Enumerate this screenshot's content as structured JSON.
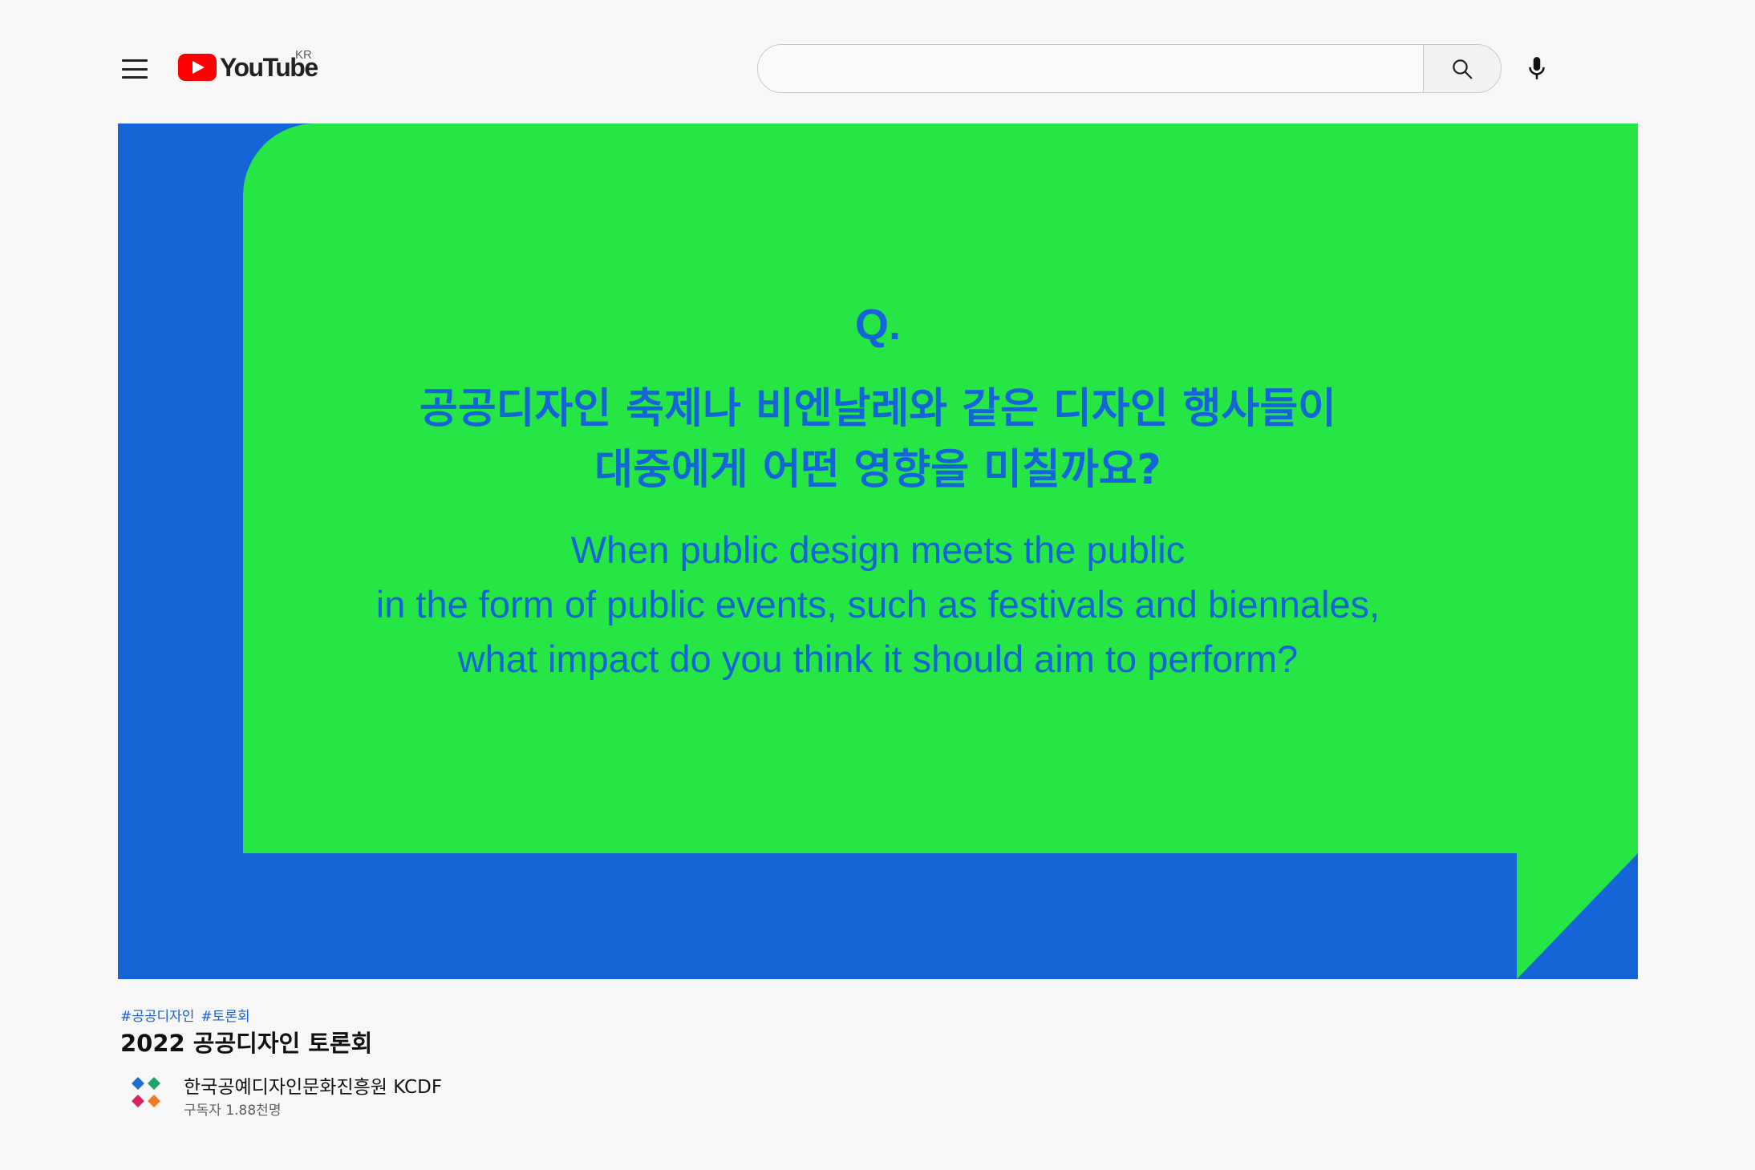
{
  "header": {
    "logo_word": "YouTube",
    "logo_region": "KR",
    "search_placeholder": "",
    "search_value": ""
  },
  "video": {
    "q_mark": "Q.",
    "question_ko": [
      "공공디자인 축제나 비엔날레와 같은 디자인 행사들이",
      "대중에게 어떤 영향을 미칠까요?"
    ],
    "question_en": [
      "When public design meets the public",
      "in the form of public events, such as festivals and biennales,",
      "what impact do you think it should aim to perform?"
    ]
  },
  "info": {
    "hashtags": [
      "#공공디자인",
      "#토론회"
    ],
    "title": "2022 공공디자인 토론회",
    "channel_name": "한국공예디자인문화진흥원 KCDF",
    "subscribers": "구독자 1.88천명"
  },
  "colors": {
    "video_blue": "#1565d8",
    "bubble_green": "#26e646",
    "youtube_red": "#ff0000",
    "hashtag_blue": "#1a5dd6"
  },
  "icons": {
    "menu": "hamburger-menu-icon",
    "search": "search-icon",
    "mic": "microphone-icon",
    "channel": "kcdf-logo-icon"
  }
}
